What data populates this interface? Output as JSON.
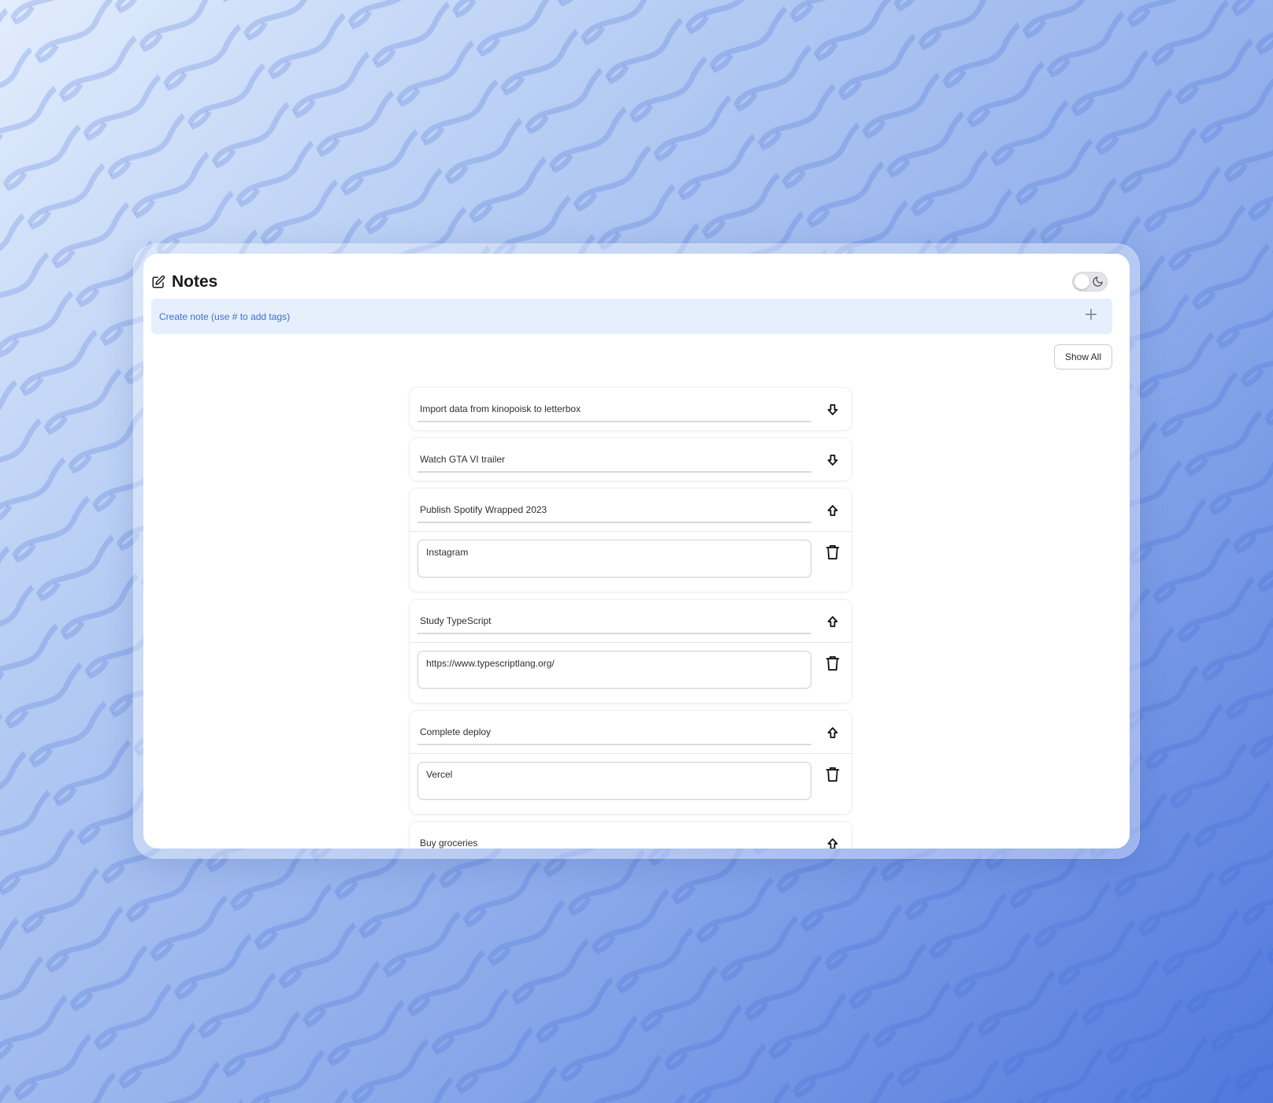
{
  "app": {
    "title": "Notes"
  },
  "create": {
    "placeholder": "Create note (use # to add tags)"
  },
  "toolbar": {
    "show_all_label": "Show All"
  },
  "notes": [
    {
      "title": "Import data from kinopoisk to letterbox",
      "expanded": false,
      "arrow": "down",
      "body": ""
    },
    {
      "title": "Watch GTA VI trailer",
      "expanded": false,
      "arrow": "down",
      "body": ""
    },
    {
      "title": "Publish Spotify Wrapped 2023",
      "expanded": true,
      "arrow": "up",
      "body": "Instagram"
    },
    {
      "title": "Study TypeScript",
      "expanded": true,
      "arrow": "up",
      "body": "https://www.typescriptlang.org/"
    },
    {
      "title": "Complete deploy",
      "expanded": true,
      "arrow": "up",
      "body": "Vercel"
    },
    {
      "title": "Buy groceries",
      "expanded": true,
      "arrow": "up",
      "body": ""
    }
  ],
  "icons": {
    "edit": "edit-icon",
    "theme": "moon-icon",
    "add": "plus-icon",
    "collapse": "arrow-up-icon",
    "expand": "arrow-down-icon",
    "delete": "trash-icon"
  },
  "colors": {
    "accent": "#3d6fd9",
    "create_bar_bg": "#e6effc",
    "background_start": "#e2edfd",
    "background_end": "#5077dd"
  }
}
